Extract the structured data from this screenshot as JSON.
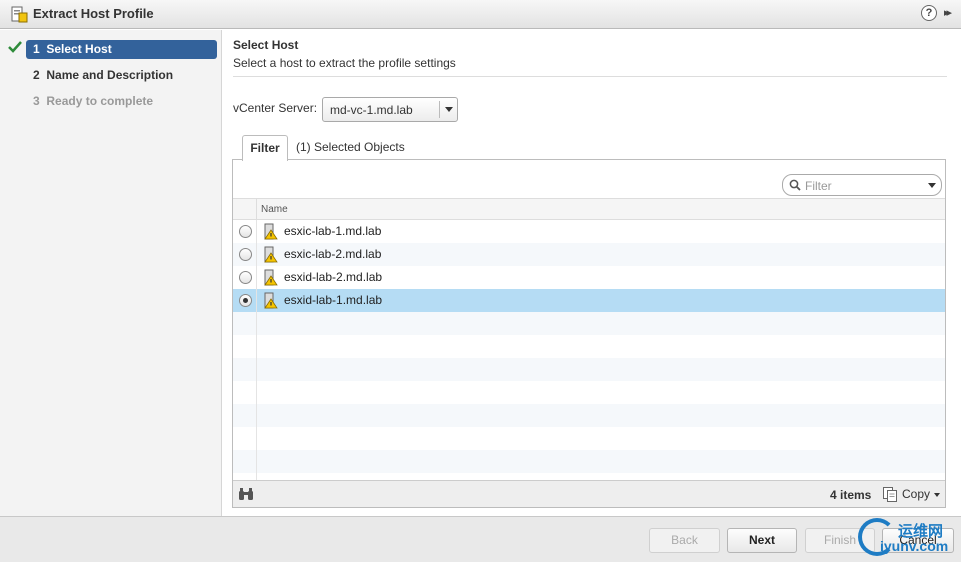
{
  "window": {
    "title": "Extract Host Profile",
    "help_label": "?",
    "expand_label": "▸▸"
  },
  "steps": [
    {
      "num": "1",
      "label": "Select Host",
      "state": "active"
    },
    {
      "num": "2",
      "label": "Name and Description",
      "state": "done"
    },
    {
      "num": "3",
      "label": "Ready to complete",
      "state": "pending"
    }
  ],
  "header": {
    "title": "Select Host",
    "subtitle": "Select a host to extract the profile settings"
  },
  "vcenter": {
    "label": "vCenter Server:",
    "value": "md-vc-1.md.lab"
  },
  "tabs": {
    "filter": "Filter",
    "selected": "(1) Selected Objects"
  },
  "filter": {
    "placeholder": "Filter"
  },
  "grid": {
    "column_name": "Name",
    "rows": [
      {
        "name": "esxic-lab-1.md.lab",
        "selected": false
      },
      {
        "name": "esxic-lab-2.md.lab",
        "selected": false
      },
      {
        "name": "esxid-lab-2.md.lab",
        "selected": false
      },
      {
        "name": "esxid-lab-1.md.lab",
        "selected": true
      }
    ],
    "items_count": "4 items",
    "copy_label": "Copy"
  },
  "buttons": {
    "back": "Back",
    "next": "Next",
    "finish": "Finish",
    "cancel": "Cancel"
  },
  "watermark": {
    "cn": "运维网",
    "url": "iyunv.com"
  },
  "colors": {
    "active_step": "#33629b",
    "selected_row": "#b5dcf4",
    "check": "#2e8b3a"
  }
}
